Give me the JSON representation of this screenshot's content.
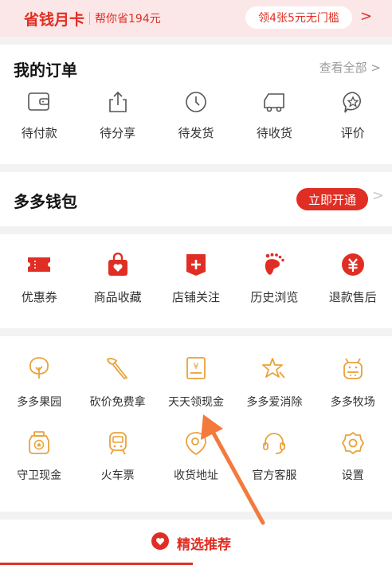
{
  "banner": {
    "title": "省钱月卡",
    "subtitle": "帮你省194元",
    "pill": "领4张5元无门槛",
    "arrow": ">"
  },
  "orders": {
    "title": "我的订单",
    "view_all": "查看全部 >",
    "items": [
      {
        "label": "待付款",
        "icon": "wallet-icon"
      },
      {
        "label": "待分享",
        "icon": "share-icon"
      },
      {
        "label": "待发货",
        "icon": "clock-icon"
      },
      {
        "label": "待收货",
        "icon": "truck-icon"
      },
      {
        "label": "评价",
        "icon": "star-bubble-icon"
      }
    ]
  },
  "wallet": {
    "title": "多多钱包",
    "button": "立即开通",
    "arrow": ">"
  },
  "services": {
    "items": [
      {
        "label": "优惠券",
        "icon": "ticket-icon"
      },
      {
        "label": "商品收藏",
        "icon": "heart-bag-icon"
      },
      {
        "label": "店铺关注",
        "icon": "store-plus-icon"
      },
      {
        "label": "历史浏览",
        "icon": "footprint-icon"
      },
      {
        "label": "退款售后",
        "icon": "yuan-icon"
      }
    ]
  },
  "tools": {
    "row1": [
      {
        "label": "多多果园",
        "icon": "tree-icon"
      },
      {
        "label": "砍价免费拿",
        "icon": "axe-icon"
      },
      {
        "label": "天天领现金",
        "icon": "red-envelope-icon"
      },
      {
        "label": "多多爱消除",
        "icon": "star-burst-icon"
      },
      {
        "label": "多多牧场",
        "icon": "cow-icon"
      }
    ],
    "row2": [
      {
        "label": "守卫现金",
        "icon": "badge-icon"
      },
      {
        "label": "火车票",
        "icon": "train-icon"
      },
      {
        "label": "收货地址",
        "icon": "location-icon"
      },
      {
        "label": "官方客服",
        "icon": "headset-icon"
      },
      {
        "label": "设置",
        "icon": "gear-icon"
      }
    ]
  },
  "recommend": {
    "label": "精选推荐",
    "icon": "heart-circle-icon"
  },
  "colors": {
    "brand_red": "#e02e24",
    "tool_orange": "#e9a23b",
    "annotation_arrow": "#f37a3c"
  }
}
